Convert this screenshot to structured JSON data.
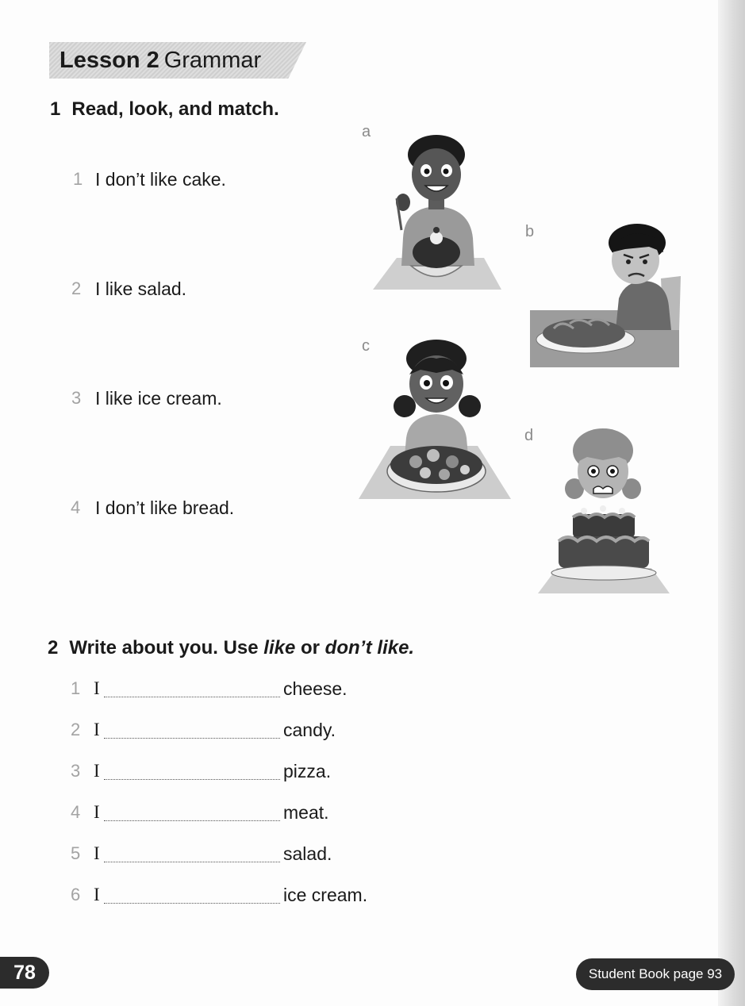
{
  "lesson": {
    "number_label": "Lesson 2",
    "name": "Grammar"
  },
  "exercise1": {
    "number": "1",
    "heading": "Read, look, and match.",
    "items": [
      {
        "num": "1",
        "text": "I don’t like cake."
      },
      {
        "num": "2",
        "text": "I like salad."
      },
      {
        "num": "3",
        "text": "I like ice cream."
      },
      {
        "num": "4",
        "text": "I don’t like bread."
      }
    ],
    "pictures": [
      {
        "letter": "a",
        "icon": "boy-smiling-with-ice-cream-sundae-illustration"
      },
      {
        "letter": "b",
        "icon": "boy-frowning-at-bread-illustration"
      },
      {
        "letter": "c",
        "icon": "girl-smiling-with-salad-illustration"
      },
      {
        "letter": "d",
        "icon": "girl-disgusted-by-cake-illustration"
      }
    ]
  },
  "exercise2": {
    "number": "2",
    "heading_start": "Write about you. Use ",
    "heading_like": "like",
    "heading_or": " or ",
    "heading_dont_like": "don’t like.",
    "items": [
      {
        "num": "1",
        "subject": "I",
        "word": "cheese."
      },
      {
        "num": "2",
        "subject": "I",
        "word": "candy."
      },
      {
        "num": "3",
        "subject": "I",
        "word": "pizza."
      },
      {
        "num": "4",
        "subject": "I",
        "word": "meat."
      },
      {
        "num": "5",
        "subject": "I",
        "word": "salad."
      },
      {
        "num": "6",
        "subject": "I",
        "word": "ice cream."
      }
    ]
  },
  "footer": {
    "page_number": "78",
    "reference": "Student Book page 93"
  }
}
